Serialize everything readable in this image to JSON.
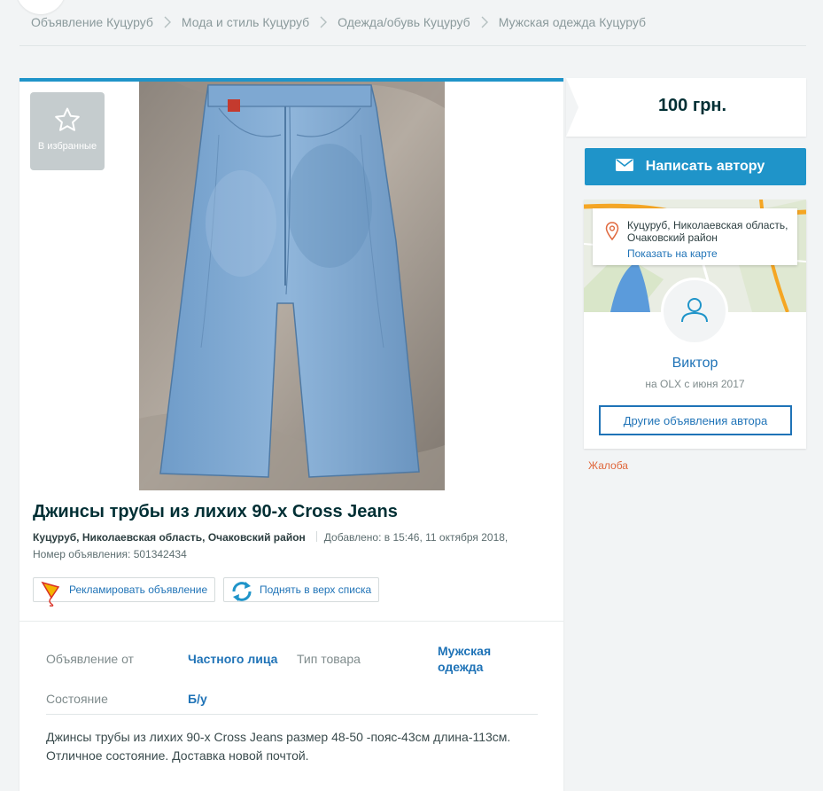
{
  "breadcrumb": [
    "Объявление Куцуруб",
    "Мода и стиль Куцуруб",
    "Одежда/обувь Куцуруб",
    "Мужская одежда Куцуруб"
  ],
  "favorite": {
    "label": "В избранные",
    "icon": "star-icon"
  },
  "listing": {
    "title": "Джинсы трубы из лихих 90-х Cross Jeans",
    "location": "Куцуруб, Николаевская область, Очаковский район",
    "added": "Добавлено: в 15:46, 11 октября 2018,",
    "ad_number": "Номер объявления: 501342434"
  },
  "actions": {
    "promote": "Рекламировать объявление",
    "bump": "Поднять в верх списка"
  },
  "attributes": [
    {
      "label": "Объявление от",
      "value": "Частного лица"
    },
    {
      "label": "Тип товара",
      "value": "Мужская одежда"
    },
    {
      "label": "Состояние",
      "value": "Б/у"
    }
  ],
  "description": "Джинсы трубы из лихих 90-х Cross Jeans размер 48-50 -пояс-43см длина-113см. Отличное состояние. Доставка новой почтой.",
  "sidebar": {
    "price": "100 грн.",
    "write_author": "Написать автору",
    "location": "Куцуруб, Николаевская область, Очаковский район",
    "show_on_map": "Показать на карте",
    "author_name": "Виктор",
    "author_since": "на OLX с июня 2017",
    "other_ads": "Другие объявления автора",
    "complaint": "Жалоба"
  },
  "colors": {
    "accent_blue": "#1f94c9",
    "link_blue": "#1f73b7",
    "complaint_orange": "#e0683d",
    "background": "#f2f4f5"
  }
}
